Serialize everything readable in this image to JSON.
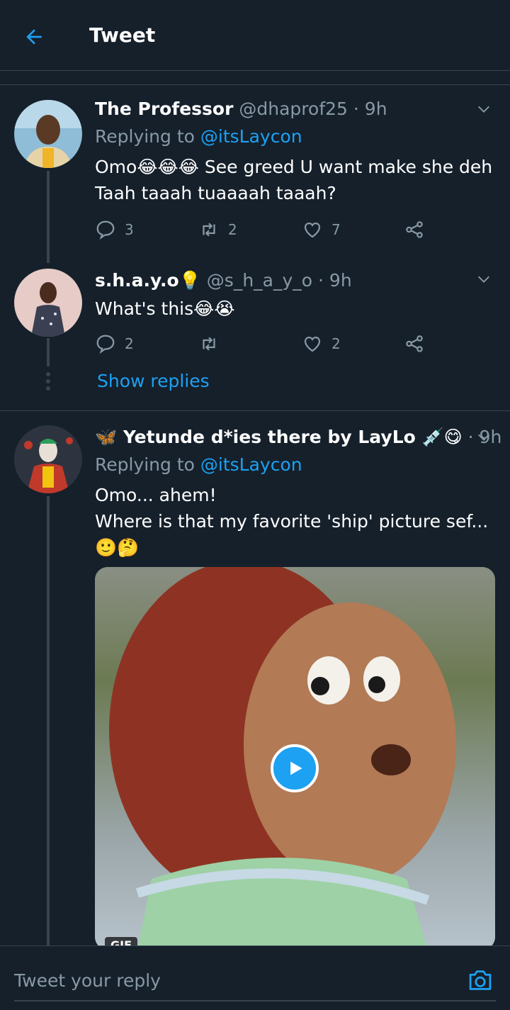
{
  "header": {
    "title": "Tweet"
  },
  "tweets": [
    {
      "name": "The Professor",
      "handle": "@dhaprof25",
      "time": "· 9h",
      "replying_prefix": "Replying to",
      "replying_to": "@itsLaycon",
      "lines": [
        "Omo😂😂😂 See greed U want make she deh",
        "Taah taaah tuaaaah taaah?"
      ],
      "replies": "3",
      "retweets": "2",
      "likes": "7"
    },
    {
      "name": "s.h.a.y.o💡",
      "handle": "@s_h_a_y_o",
      "time": "· 9h",
      "lines": [
        "What's this😂😭"
      ],
      "replies": "2",
      "retweets": "",
      "likes": "2"
    },
    {
      "name": "🦋 Yetunde d*ies there by LayLo 💉😋",
      "handle": "",
      "time": "· 9h",
      "replying_prefix": "Replying to",
      "replying_to": "@itsLaycon",
      "lines": [
        "Omo... ahem!",
        "Where is that my favorite 'ship' picture sef...",
        "🙂🤔"
      ],
      "media_badge": "GIF"
    }
  ],
  "show_replies": "Show replies",
  "reply_bar": {
    "placeholder": "Tweet your reply"
  },
  "colors": {
    "background": "#15202b",
    "accent": "#1da1f2",
    "muted": "#8899a6",
    "border": "#38444d"
  }
}
